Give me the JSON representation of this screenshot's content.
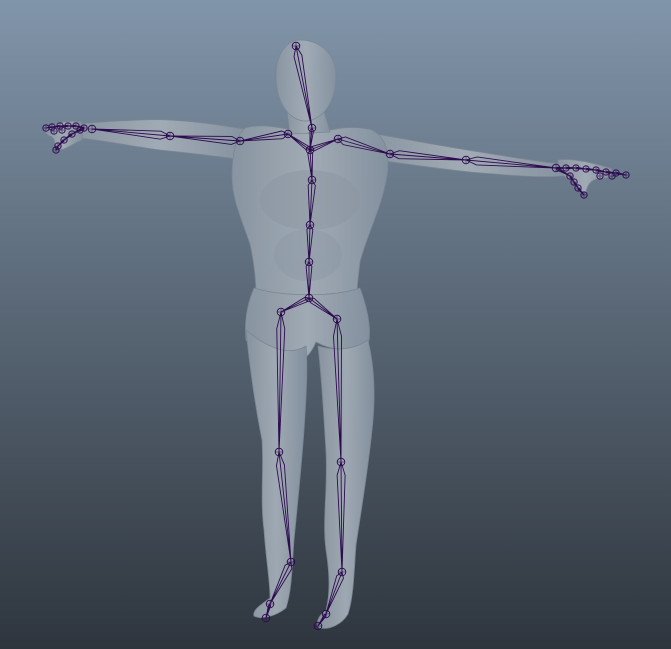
{
  "viewport": {
    "background_top_color": "#8195aa",
    "background_bottom_color": "#2e353d",
    "mesh_color": "#9aa5b0",
    "mesh_shadow_color": "#7f8a96",
    "joint_color": "#2d0b4f",
    "bone_color": "#2d0b4f"
  }
}
